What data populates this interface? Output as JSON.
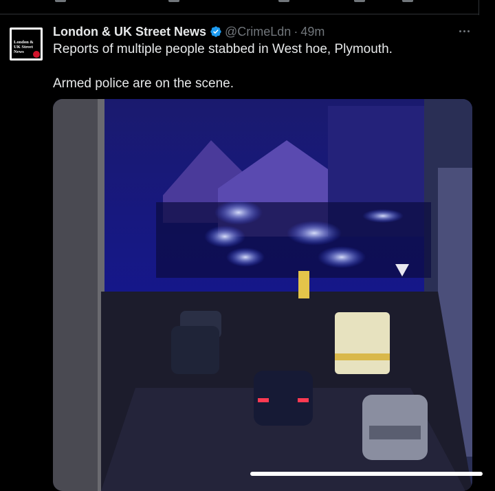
{
  "tweet": {
    "author_name": "London & UK Street News",
    "handle": "@CrimeLdn",
    "separator": "·",
    "time": "49m",
    "verified_color": "#1d9bf0",
    "text_line1": "Reports of multiple people stabbed in West hoe, Plymouth.",
    "text_line2": "Armed police are on the scene."
  },
  "avatar": {
    "logo_line1": "London &",
    "logo_line2": "UK Street",
    "logo_line3": "News"
  },
  "media": {
    "type": "video",
    "icon": "video-frame"
  }
}
